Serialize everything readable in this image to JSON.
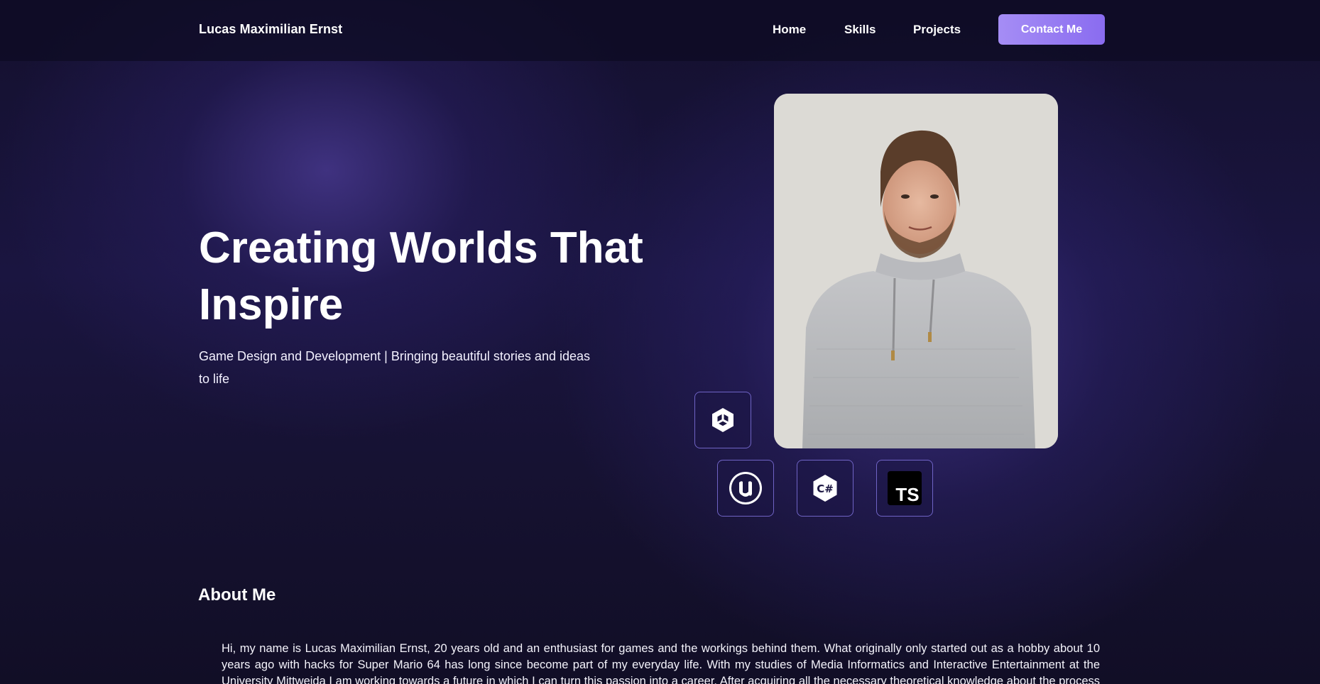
{
  "header": {
    "brand": "Lucas Maximilian Ernst",
    "nav": [
      {
        "label": "Home"
      },
      {
        "label": "Skills"
      },
      {
        "label": "Projects"
      }
    ],
    "contact_label": "Contact Me"
  },
  "hero": {
    "title": "Creating Worlds That Inspire",
    "subtitle": "Game Design and Development | Bringing beautiful stories and ideas to life",
    "portrait_icon": "person-photo"
  },
  "skills": [
    {
      "icon": "unity-icon"
    },
    {
      "icon": "unreal-engine-icon"
    },
    {
      "icon": "csharp-icon"
    },
    {
      "icon": "typescript-icon",
      "text": "TS"
    }
  ],
  "about": {
    "heading": "About Me",
    "text": "Hi, my name is Lucas Maximilian Ernst, 20 years old and an enthusiast for games and the workings behind them. What originally only started out as a hobby about 10 years ago with hacks for Super Mario 64 has long since become part of my everyday life. With my studies of Media Informatics and Interactive Entertainment at the University Mittweida I am working towards a future in which I can turn this passion into a career. After acquiring all the necessary theoretical knowledge about the process behind"
  },
  "colors": {
    "accent": "#9a7ff3",
    "background": "#1a1540",
    "tile_border": "#8c7df0"
  }
}
